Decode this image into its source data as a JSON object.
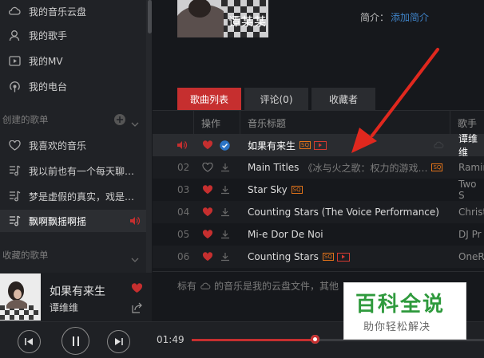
{
  "sidebar": {
    "items": [
      {
        "label": "我的音乐云盘",
        "icon": "cloud-icon"
      },
      {
        "label": "我的歌手",
        "icon": "person-icon"
      },
      {
        "label": "我的MV",
        "icon": "video-icon"
      },
      {
        "label": "我的电台",
        "icon": "radio-icon"
      }
    ],
    "created_header": "创建的歌单",
    "playlists": [
      {
        "label": "我喜欢的音乐",
        "icon": "heart-outline-icon"
      },
      {
        "label": "我以前也有一个每天聊到…",
        "icon": "playlist-icon"
      },
      {
        "label": "梦是虚假的真实，戏是真…",
        "icon": "playlist-icon"
      },
      {
        "label": "飘啊飘摇啊摇",
        "icon": "playlist-icon"
      }
    ],
    "collected_header": "收藏的歌单"
  },
  "now_playing": {
    "title": "如果有来生",
    "artist": "谭维维"
  },
  "album": {
    "art_text": "谭某某"
  },
  "info": {
    "intro_label": "简介：",
    "intro_link": "添加简介"
  },
  "tabs": [
    {
      "label": "歌曲列表",
      "active": true
    },
    {
      "label": "评论(0)",
      "active": false
    },
    {
      "label": "收藏者",
      "active": false
    }
  ],
  "table": {
    "headers": {
      "ops": "操作",
      "title": "音乐标题",
      "artist": "歌手"
    },
    "rows": [
      {
        "num": "",
        "title": "如果有来生",
        "artist": "谭维维",
        "sq": true,
        "mv": true,
        "liked": true,
        "playing": true
      },
      {
        "num": "02",
        "title": "Main Titles",
        "subtitle": "《冰与火之歌：权力的游戏…",
        "artist": "Ramin",
        "sq": true,
        "mv": false,
        "liked": false,
        "playing": false
      },
      {
        "num": "03",
        "title": "Star Sky",
        "artist": "Two S",
        "sq": true,
        "mv": false,
        "liked": true,
        "playing": false
      },
      {
        "num": "04",
        "title": "Counting Stars (The Voice Performance)",
        "artist": "Christ",
        "sq": false,
        "mv": false,
        "liked": true,
        "playing": false
      },
      {
        "num": "05",
        "title": "Mi-e Dor De Noi",
        "artist": "DJ Pr",
        "sq": false,
        "mv": false,
        "liked": true,
        "playing": false
      },
      {
        "num": "06",
        "title": "Counting Stars",
        "artist": "OneR",
        "sq": true,
        "mv": true,
        "liked": true,
        "playing": false
      }
    ],
    "footnote_prefix": "标有",
    "footnote_rest": "的音乐是我的云盘文件，其他"
  },
  "sq_badge": "SQ",
  "player": {
    "time": "01:49",
    "progress": 0.42
  },
  "watermark": {
    "title": "百科全说",
    "subtitle": "助你轻松解决"
  },
  "colors": {
    "accent": "#c62f2f",
    "sq": "#e2731a",
    "check": "#2c74c6"
  }
}
